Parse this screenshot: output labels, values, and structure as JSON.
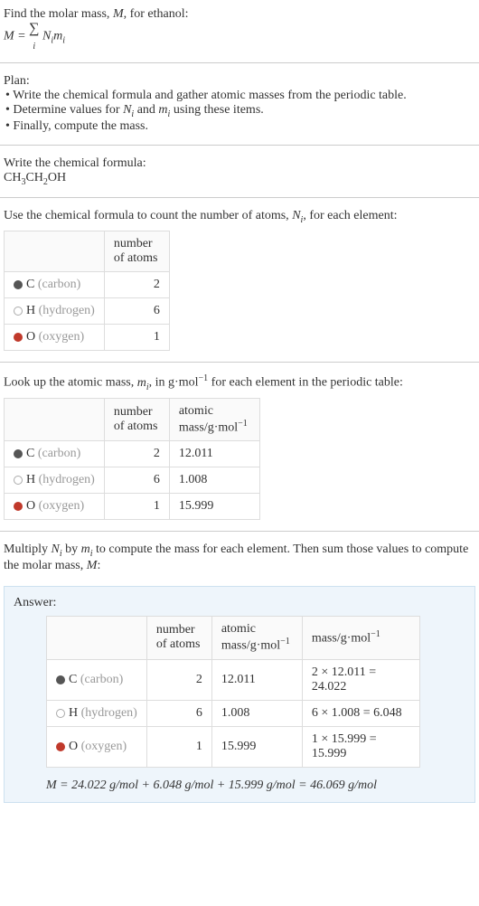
{
  "intro": {
    "line1_a": "Find the molar mass, ",
    "line1_b": ", for ethanol:",
    "var_M": "M",
    "eq_lhs": "M = ",
    "eq_sum": "∑",
    "eq_idx": "i",
    "eq_rhs": " N",
    "eq_rhs2": "m"
  },
  "plan": {
    "title": "Plan:",
    "b1": "• Write the chemical formula and gather atomic masses from the periodic table.",
    "b2_a": "• Determine values for ",
    "b2_b": " and ",
    "b2_c": " using these items.",
    "b3": "• Finally, compute the mass."
  },
  "formula": {
    "title": "Write the chemical formula:",
    "p1": "CH",
    "s1": "3",
    "p2": "CH",
    "s2": "2",
    "p3": "OH"
  },
  "count": {
    "title_a": "Use the chemical formula to count the number of atoms, ",
    "title_b": ", for each element:",
    "var_N": "N",
    "var_i": "i",
    "col_atoms": "number of atoms",
    "rows": [
      {
        "name": "C",
        "role": "(carbon)",
        "swatch": "carbon",
        "atoms": "2"
      },
      {
        "name": "H",
        "role": "(hydrogen)",
        "swatch": "hydrogen",
        "atoms": "6"
      },
      {
        "name": "O",
        "role": "(oxygen)",
        "swatch": "oxygen",
        "atoms": "1"
      }
    ]
  },
  "lookup": {
    "title_a": "Look up the atomic mass, ",
    "title_b": ", in g·mol",
    "title_c": " for each element in the periodic table:",
    "var_m": "m",
    "var_i": "i",
    "exp": "−1",
    "col_atoms": "number of atoms",
    "col_mass": "atomic mass/g·mol",
    "rows": [
      {
        "name": "C",
        "role": "(carbon)",
        "swatch": "carbon",
        "atoms": "2",
        "mass": "12.011"
      },
      {
        "name": "H",
        "role": "(hydrogen)",
        "swatch": "hydrogen",
        "atoms": "6",
        "mass": "1.008"
      },
      {
        "name": "O",
        "role": "(oxygen)",
        "swatch": "oxygen",
        "atoms": "1",
        "mass": "15.999"
      }
    ]
  },
  "compute": {
    "title_a": "Multiply ",
    "title_b": " by ",
    "title_c": " to compute the mass for each element. Then sum those values to compute the molar mass, ",
    "title_d": ":",
    "var_N": "N",
    "var_m": "m",
    "var_i": "i",
    "var_M": "M"
  },
  "answer": {
    "label": "Answer:",
    "col_atoms": "number of atoms",
    "col_amass": "atomic mass/g·mol",
    "col_mass": "mass/g·mol",
    "exp": "−1",
    "rows": [
      {
        "name": "C",
        "role": "(carbon)",
        "swatch": "carbon",
        "atoms": "2",
        "amass": "12.011",
        "mass": "2 × 12.011 = 24.022"
      },
      {
        "name": "H",
        "role": "(hydrogen)",
        "swatch": "hydrogen",
        "atoms": "6",
        "amass": "1.008",
        "mass": "6 × 1.008 = 6.048"
      },
      {
        "name": "O",
        "role": "(oxygen)",
        "swatch": "oxygen",
        "atoms": "1",
        "amass": "15.999",
        "mass": "1 × 15.999 = 15.999"
      }
    ],
    "final": "M = 24.022 g/mol + 6.048 g/mol + 15.999 g/mol = 46.069 g/mol"
  }
}
